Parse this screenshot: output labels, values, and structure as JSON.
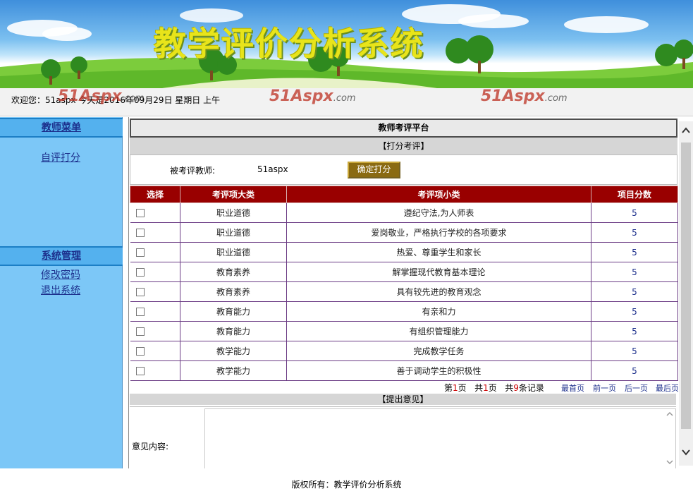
{
  "banner": {
    "title": "教学评价分析系统"
  },
  "header": {
    "welcome": "欢迎您：51aspx   今天是2016年09月29日   星期日   上午",
    "watermark_main": "51Aspx",
    "watermark_suffix": ".com"
  },
  "sidebar": {
    "teacher_menu": {
      "title": "教师菜单",
      "items": [
        {
          "label": "自评打分"
        }
      ]
    },
    "system_menu": {
      "title": "系统管理",
      "items": [
        {
          "label": "修改密码"
        },
        {
          "label": "退出系统"
        }
      ]
    }
  },
  "main": {
    "platform_title": "教师考评平台",
    "score_section_title": "【打分考评】",
    "teacher_label": "被考评教师:",
    "teacher_name": "51aspx",
    "confirm_button": "确定打分",
    "table": {
      "headers": [
        "选择",
        "考评项大类",
        "考评项小类",
        "项目分数"
      ],
      "rows": [
        {
          "category": "职业道德",
          "subcategory": "遵纪守法,为人师表",
          "score": "5"
        },
        {
          "category": "职业道德",
          "subcategory": "爱岗敬业，严格执行学校的各项要求",
          "score": "5"
        },
        {
          "category": "职业道德",
          "subcategory": "热爱、尊重学生和家长",
          "score": "5"
        },
        {
          "category": "教育素养",
          "subcategory": "解掌握现代教育基本理论",
          "score": "5"
        },
        {
          "category": "教育素养",
          "subcategory": "具有较先进的教育观念",
          "score": "5"
        },
        {
          "category": "教育能力",
          "subcategory": "有亲和力",
          "score": "5"
        },
        {
          "category": "教育能力",
          "subcategory": "有组织管理能力",
          "score": "5"
        },
        {
          "category": "教学能力",
          "subcategory": "完成教学任务",
          "score": "5"
        },
        {
          "category": "教学能力",
          "subcategory": "善于调动学生的积极性",
          "score": "5"
        }
      ]
    },
    "pager": {
      "page_prefix": "第",
      "current_page": "1",
      "page_suffix": "页",
      "total_prefix": "共",
      "total_pages": "1",
      "total_suffix": "页",
      "records_prefix": "共",
      "total_records": "9",
      "records_suffix": "条记录",
      "first": "最首页",
      "prev": "前一页",
      "next": "后一页",
      "last": "最后页"
    },
    "opinion_section_title": "【提出意见】",
    "opinion_label": "意见内容:"
  },
  "footer": {
    "copyright": "版权所有：教学评价分析系统"
  }
}
